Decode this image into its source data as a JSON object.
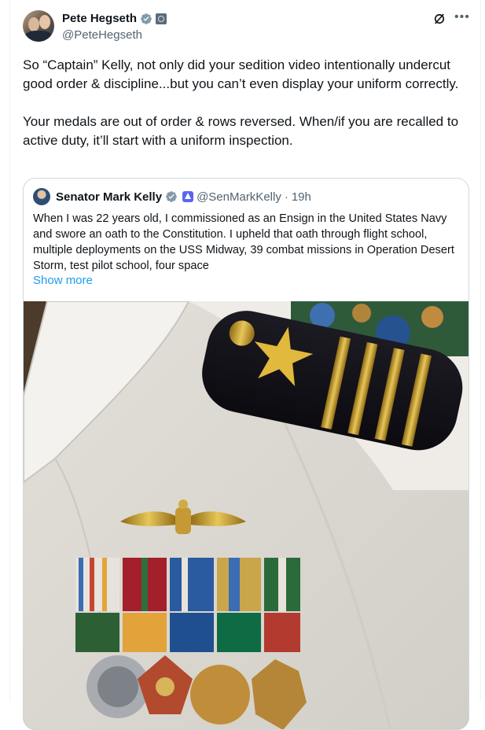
{
  "post": {
    "author_name": "Pete Hegseth",
    "author_handle": "@PeteHegseth",
    "paragraphs": [
      "So “Captain” Kelly, not only did your sedition video intentionally undercut good order & discipline...but you can’t even display your uniform correctly.",
      "Your medals are out of order & rows reversed. When/if you are recalled to active duty, it’ll start with a uniform inspection."
    ]
  },
  "quoted": {
    "author_name": "Senator Mark Kelly",
    "author_handle": "@SenMarkKelly",
    "separator": "·",
    "time": "19h",
    "text": "When I was 22 years old, I commissioned as an Ensign in the United States Navy and swore an oath to the Constitution. I upheld that oath through flight school, multiple deployments on the USS Midway, 39 combat missions in Operation Desert Storm, test pilot school, four space",
    "show_more": "Show more"
  },
  "icons": {
    "verified": "verified-badge-icon",
    "affiliation": "affiliation-badge-icon",
    "grok": "grok-icon",
    "more": "more-icon"
  },
  "colors": {
    "link": "#1d9bf0",
    "verified": "#829aab",
    "secondary_text": "#536471"
  }
}
